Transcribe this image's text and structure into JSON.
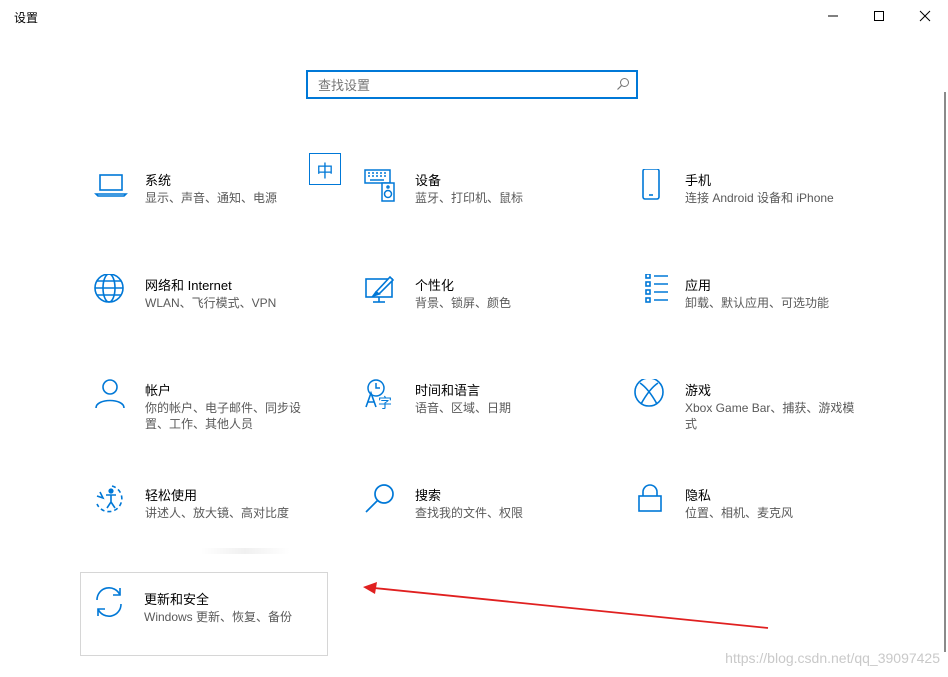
{
  "window": {
    "title": "设置",
    "controls": [
      "minimize-icon",
      "maximize-icon",
      "close-icon"
    ]
  },
  "search": {
    "placeholder": "查找设置",
    "value": ""
  },
  "ime_indicator": "中",
  "colors": {
    "accent": "#0078d7",
    "annotation_arrow": "#e02020",
    "description": "#595959"
  },
  "tiles": [
    {
      "name": "系统",
      "desc": "显示、声音、通知、电源",
      "icon": "laptop-icon"
    },
    {
      "name": "设备",
      "desc": "蓝牙、打印机、鼠标",
      "icon": "keyboard-speaker-icon"
    },
    {
      "name": "手机",
      "desc": "连接 Android 设备和 iPhone",
      "icon": "phone-icon"
    },
    {
      "name": "网络和 Internet",
      "desc": "WLAN、飞行模式、VPN",
      "icon": "globe-icon"
    },
    {
      "name": "个性化",
      "desc": "背景、锁屏、颜色",
      "icon": "paint-monitor-icon"
    },
    {
      "name": "应用",
      "desc": "卸载、默认应用、可选功能",
      "icon": "app-list-icon"
    },
    {
      "name": "帐户",
      "desc": "你的帐户、电子邮件、同步设置、工作、其他人员",
      "icon": "person-icon"
    },
    {
      "name": "时间和语言",
      "desc": "语音、区域、日期",
      "icon": "clock-language-icon"
    },
    {
      "name": "游戏",
      "desc": "Xbox Game Bar、捕获、游戏模式",
      "icon": "xbox-icon"
    },
    {
      "name": "轻松使用",
      "desc": "讲述人、放大镜、高对比度",
      "icon": "ease-of-access-icon"
    },
    {
      "name": "搜索",
      "desc": "查找我的文件、权限",
      "icon": "magnifier-icon"
    },
    {
      "name": "隐私",
      "desc": "位置、相机、麦克风",
      "icon": "lock-icon"
    }
  ],
  "highlighted_tile": {
    "name": "更新和安全",
    "desc": "Windows 更新、恢复、备份",
    "icon": "sync-icon"
  },
  "watermark": "https://blog.csdn.net/qq_39097425"
}
